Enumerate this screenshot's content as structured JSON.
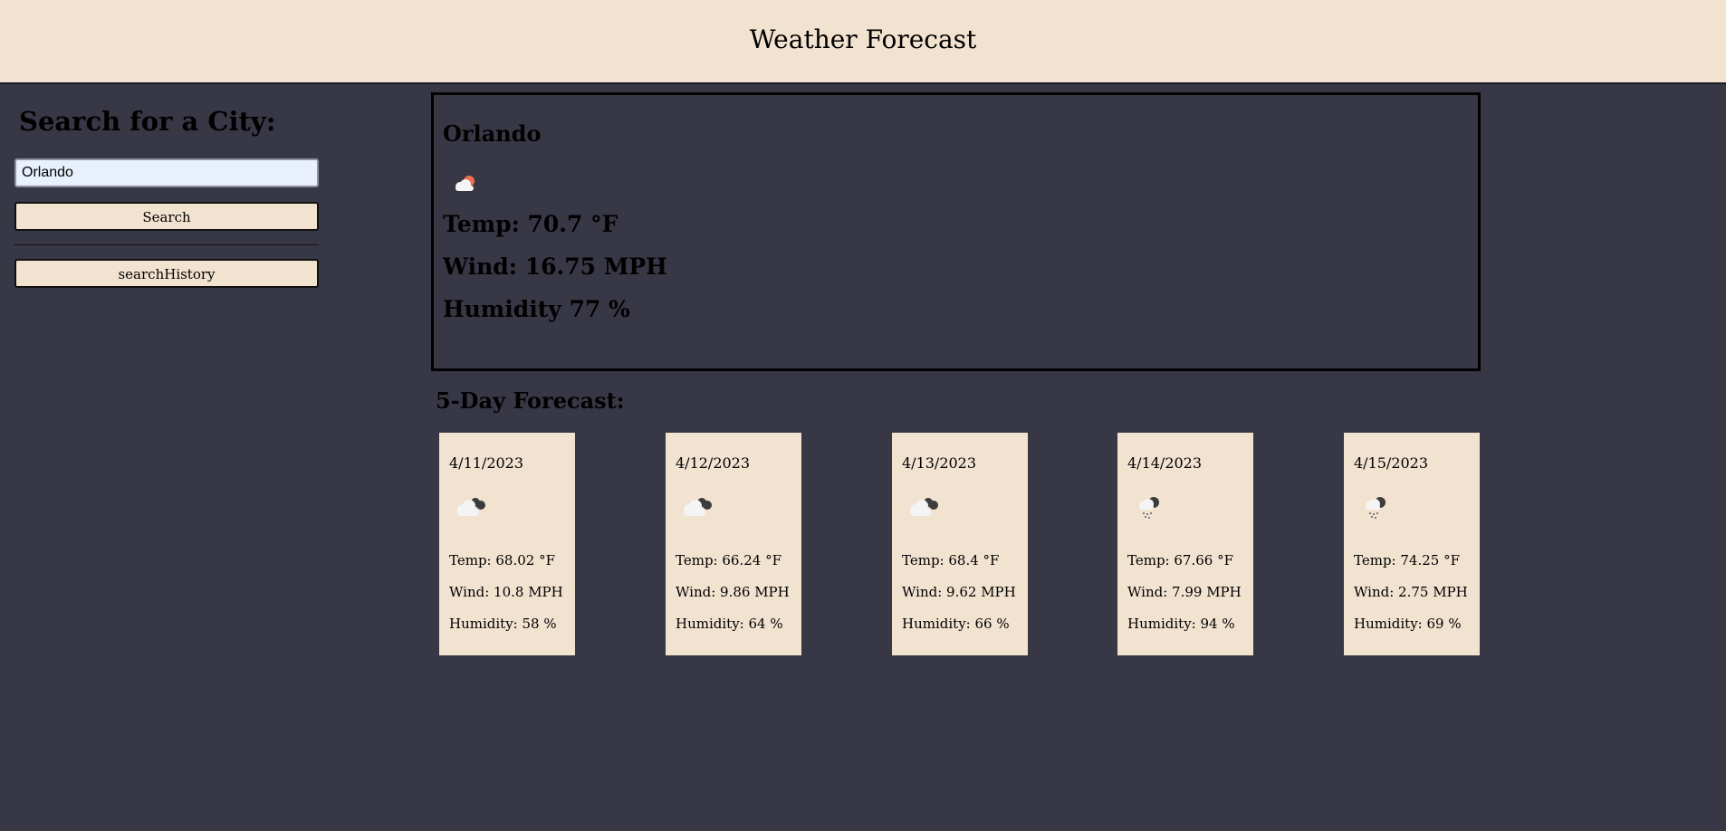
{
  "header": {
    "title": "Weather Forecast"
  },
  "sidebar": {
    "heading": "Search for a City:",
    "search_value": "Orlando",
    "search_button": "Search",
    "history_button": "searchHistory"
  },
  "current": {
    "city": "Orlando",
    "icon": "sun-behind-cloud-icon",
    "temp": "Temp: 70.7 °F",
    "wind": "Wind: 16.75 MPH",
    "humidity": "Humidity 77 %"
  },
  "forecast": {
    "title": "5-Day Forecast:",
    "days": [
      {
        "date": "4/11/2023",
        "icon": "broken-clouds-icon",
        "temp": "Temp: 68.02 °F",
        "wind": "Wind: 10.8 MPH",
        "humidity": "Humidity: 58 %"
      },
      {
        "date": "4/12/2023",
        "icon": "broken-clouds-icon",
        "temp": "Temp: 66.24 °F",
        "wind": "Wind: 9.86 MPH",
        "humidity": "Humidity: 64 %"
      },
      {
        "date": "4/13/2023",
        "icon": "broken-clouds-icon",
        "temp": "Temp: 68.4 °F",
        "wind": "Wind: 9.62 MPH",
        "humidity": "Humidity: 66 %"
      },
      {
        "date": "4/14/2023",
        "icon": "rain-cloud-icon",
        "temp": "Temp: 67.66 °F",
        "wind": "Wind: 7.99 MPH",
        "humidity": "Humidity: 94 %"
      },
      {
        "date": "4/15/2023",
        "icon": "rain-cloud-icon",
        "temp": "Temp: 74.25 °F",
        "wind": "Wind: 2.75 MPH",
        "humidity": "Humidity: 69 %"
      }
    ]
  },
  "colors": {
    "background": "#373746",
    "panel": "#f2e2d0",
    "input": "#e8f0fe"
  }
}
